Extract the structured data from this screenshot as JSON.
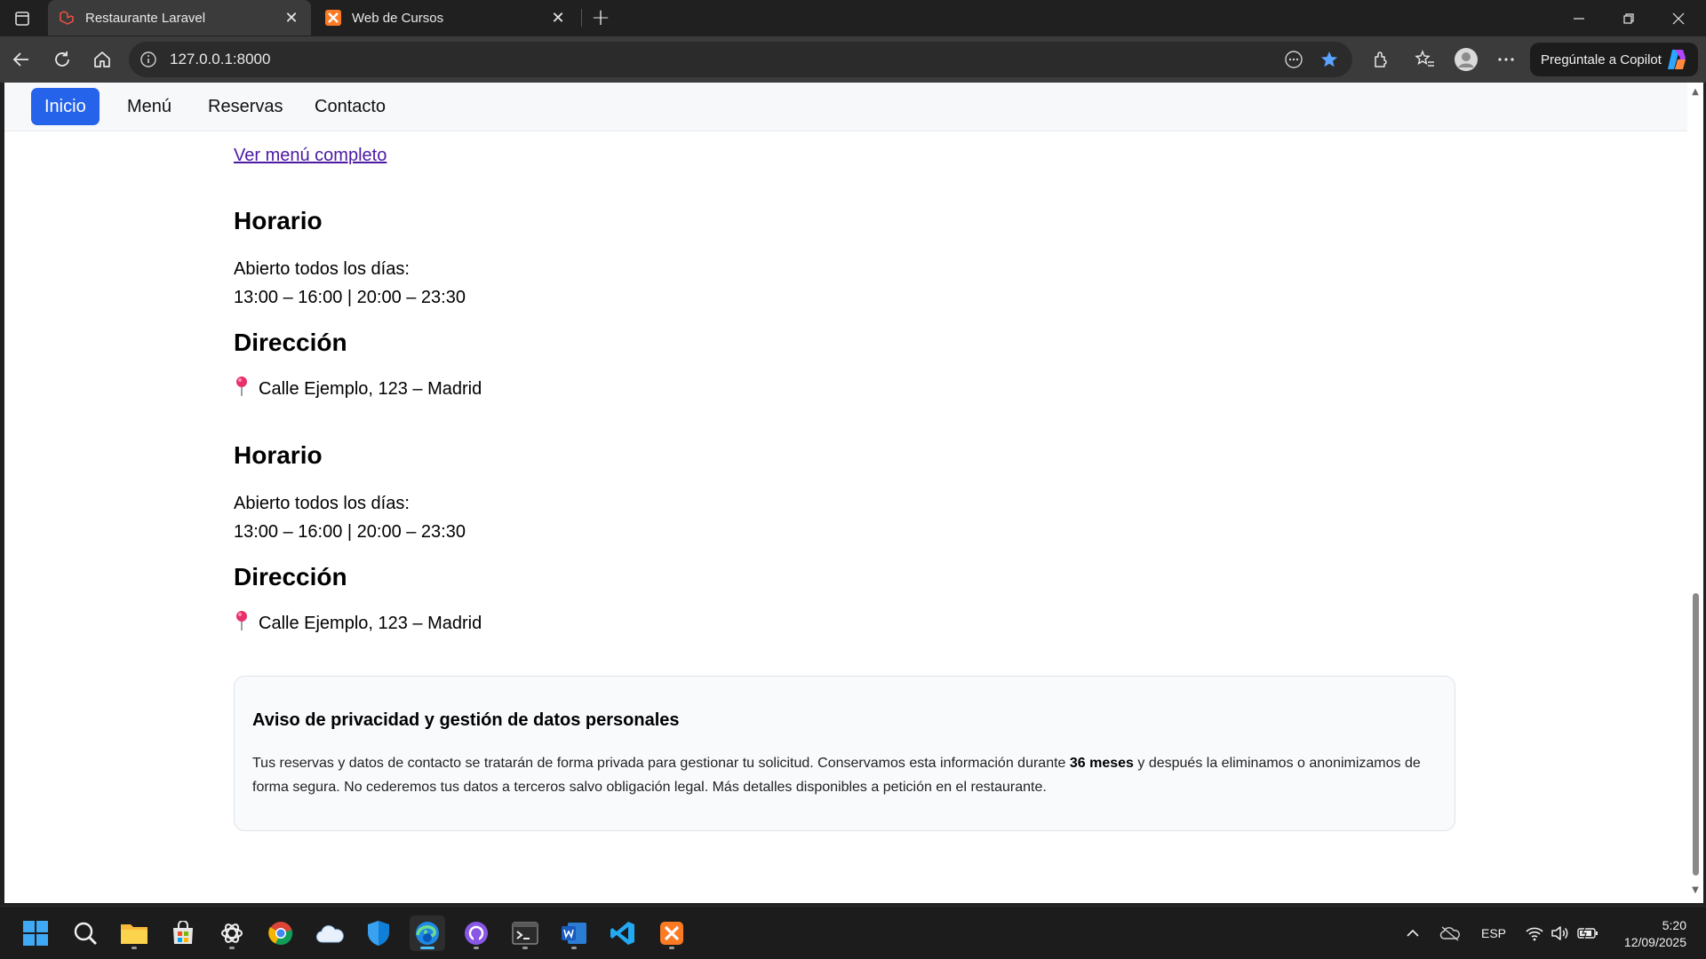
{
  "browser": {
    "tabs": [
      {
        "title": "Restaurante Laravel",
        "favicon": "laravel-icon",
        "active": true
      },
      {
        "title": "Web de Cursos",
        "favicon": "xampp-icon",
        "active": false
      }
    ],
    "url": "127.0.0.1:8000",
    "copilot_label": "Pregúntale a Copilot"
  },
  "site": {
    "nav": [
      {
        "label": "Inicio",
        "active": true
      },
      {
        "label": "Menú",
        "active": false
      },
      {
        "label": "Reservas",
        "active": false
      },
      {
        "label": "Contacto",
        "active": false
      }
    ],
    "menu_link": "Ver menú completo",
    "blocks": [
      {
        "hours_title": "Horario",
        "hours_line1": "Abierto todos los días:",
        "hours_line2": "13:00 – 16:00 | 20:00 – 23:30",
        "address_title": "Dirección",
        "address": "Calle Ejemplo, 123 – Madrid"
      },
      {
        "hours_title": "Horario",
        "hours_line1": "Abierto todos los días:",
        "hours_line2": "13:00 – 16:00 | 20:00 – 23:30",
        "address_title": "Dirección",
        "address": "Calle Ejemplo, 123 – Madrid"
      }
    ],
    "privacy": {
      "title": "Aviso de privacidad y gestión de datos personales",
      "text_before": "Tus reservas y datos de contacto se tratarán de forma privada para gestionar tu solicitud. Conservamos esta información durante ",
      "text_bold": "36 meses",
      "text_after": " y después la eliminamos o anonimizamos de forma segura. No cederemos tus datos a terceros salvo obligación legal. Más detalles disponibles a petición en el restaurante."
    }
  },
  "taskbar": {
    "apps": [
      "windows-start-icon",
      "search-icon",
      "file-explorer-icon",
      "microsoft-store-icon",
      "chatgpt-icon",
      "chrome-icon",
      "onedrive-icon",
      "defender-icon",
      "edge-icon",
      "github-icon",
      "terminal-icon",
      "word-icon",
      "vscode-icon",
      "xampp-icon"
    ],
    "language": "ESP",
    "time": "5:20",
    "date": "12/09/2025"
  },
  "colors": {
    "nav_active": "#2563eb",
    "link": "#4b1aa3",
    "edge_active": "#4cc2ff"
  }
}
